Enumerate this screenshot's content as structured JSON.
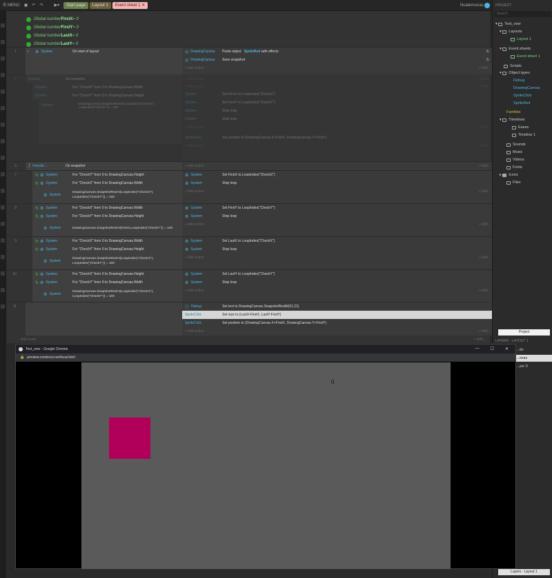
{
  "topbar": {
    "menu": "MENU",
    "tabs": [
      "Start page",
      "Layout 1",
      "Event sheet 1"
    ],
    "user": "Ncatemunas"
  },
  "globals": [
    {
      "prefix": "Global number ",
      "name": "FirstX",
      "suffix": " = 0"
    },
    {
      "prefix": "Global number ",
      "name": "FirstY",
      "suffix": " = 0"
    },
    {
      "prefix": "Global number ",
      "name": "LastX",
      "suffix": " = 0"
    },
    {
      "prefix": "Global number ",
      "name": "LastY",
      "suffix": " = 0"
    }
  ],
  "events": {
    "e1": {
      "num": "1",
      "cond": "On start of layout",
      "cond_obj": "System",
      "a1_obj": "DrawingCanvas",
      "a1_txt": "Paste object",
      "a1_extra": "SpriteRed",
      "a1_tail": "with effects",
      "a2_obj": "DrawingCanvas",
      "a2_txt": "Save snapshot",
      "add": "+ Add action"
    },
    "e2": {
      "num": "2",
      "title": "Functio...",
      "sub": "On snapshot",
      "c1": "For \"CheckX\" from 0 to DrawingCanvas.Width",
      "c2": "For \"CheckY\" from 0 to DrawingCanvas.Height",
      "c3": "DrawingCanvas.SnapshotRedAt(LoopIndex(\"CheckX\"), LoopIndex(\"CheckY\")) = 100",
      "a1": "Set FirstX to LoopIndex(\"CheckX\")",
      "a2": "Set FirstY to LoopIndex(\"CheckY\")",
      "a3": "Stop loop",
      "a4": "Stop loop",
      "a5": "Set position to (DrawingCanvas.X+FirstX, DrawingCanvas.Y+FirstY)"
    },
    "e6": {
      "num": "6",
      "title": "Functio...",
      "sub": "On snapshot"
    },
    "e7": {
      "num": "7",
      "c1": "For \"CheckY\" from 0 to DrawingCanvas.Height",
      "c2": "For \"CheckX\" from 0 to DrawingCanvas.Width",
      "c3": "DrawingCanvas.SnapshotRedAt(LoopIndex(\"CheckX\"), LoopIndex(\"CheckY\")) = 100",
      "a1": "Set FirstX to LoopIndex(\"CheckX\")",
      "a2": "Stop loop"
    },
    "e8": {
      "num": "8",
      "c1": "For \"CheckX\" from 0 to DrawingCanvas.Width",
      "c2": "For \"CheckY\" from 0 to DrawingCanvas.Height",
      "c3": "DrawingCanvas.SnapshotRedAt(FirstX,LoopIndex(\"CheckY\")) = 100",
      "a1": "Set FirstY to LoopIndex(\"CheckY\")",
      "a2": "Stop loop"
    },
    "e9": {
      "num": "9",
      "c1": "For \"CheckX\" from 0 to DrawingCanvas.Width",
      "c2": "For \"CheckY\" from 0 to DrawingCanvas.Height",
      "c3": "DrawingCanvas.SnapshotRedAt(LoopIndex(\"CheckX\"), LoopIndex(\"CheckY\")) = 100",
      "a1": "Set LastX to LoopIndex(\"CheckX\")",
      "a2": "Stop loop"
    },
    "e10": {
      "num": "10",
      "c1": "For \"CheckX\" from 0 to DrawingCanvas.Height",
      "c2": "For \"CheckY\" from 0 to DrawingCanvas.Width",
      "c3": "DrawingCanvas.SnapshotRedAt(LoopIndex(\"CheckX\"), LoopIndex(\"CheckY\")) = 100",
      "a1": "Set LastY to LoopIndex(\"CheckY\")",
      "a2": "Stop loop"
    },
    "e11": {
      "num": "11",
      "a1_obj": "Debug",
      "a1": "Set text to DrawingCanvas.SnapshotRedAt(51,21)",
      "a2_obj": "SpriteClick",
      "a2": "Set size to (LastX-FirstX, LastY-FirstY)",
      "a3_obj": "SpriteClick",
      "a3": "Set position to (DrawingCanvas.X+FirstX, DrawingCanvas.Y+FirstY)"
    },
    "system": "System",
    "add_action": "+ Add action",
    "add_short": "+ Add...",
    "add_event": "Add event"
  },
  "project": {
    "header": "PROJECT",
    "search": "Search",
    "root": "Text_over",
    "layouts": "Layouts",
    "layout1": "Layout 1",
    "eventsheets": "Event sheets",
    "eventsheet1": "Event sheet 1",
    "scripts": "Scripts",
    "objecttypes": "Object types",
    "obj1": "Debug",
    "obj2": "DrawingCanvas",
    "obj3": "SpriteClick",
    "obj4": "SpriteRed",
    "families": "Families",
    "timelines": "Timelines",
    "eases": "Eases",
    "timeline1": "Timeline 1",
    "sounds": "Sounds",
    "music": "Music",
    "videos": "Videos",
    "fonts": "Fonts",
    "icons": "Icons",
    "files": "Files",
    "project_tab": "Project",
    "layers_header": "LAYERS - LAYOUT 1",
    "layer_a": "...do",
    "layer_b": "...nvas",
    "layer_c": "...yer 0",
    "layers_tab": "Layers - Layout 1"
  },
  "browser": {
    "title": "Text_over - Google Chrome",
    "url": "preview.construct.net/local.html",
    "counter": "0"
  }
}
